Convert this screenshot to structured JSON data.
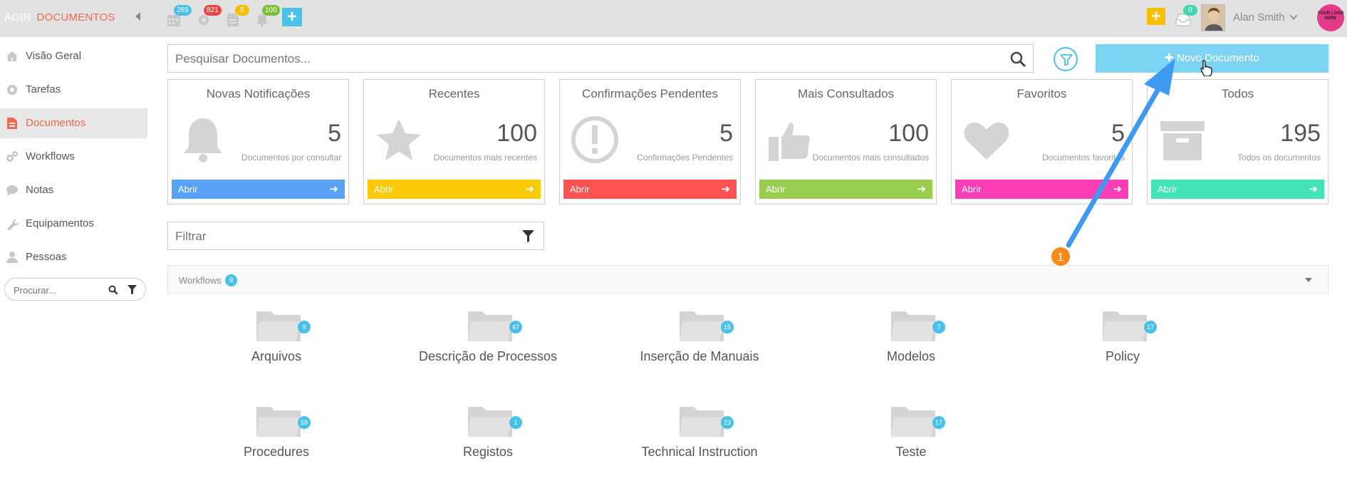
{
  "topbar": {
    "brand_part1": "AGIR",
    "brand_part2": "DOCUMENTOS",
    "calendar_badge": "269",
    "settings_badge": "821",
    "document_badge": "5",
    "bell_badge": "100",
    "inbox_badge": "0",
    "user_name": "Alan Smith",
    "logo_text": "YOUR LOGO HERE",
    "colors": {
      "calendar": "#49c0e8",
      "settings": "#ee4444",
      "document": "#f6c000",
      "bell": "#7cbd3a"
    }
  },
  "sidebar": {
    "items": [
      {
        "label": "Visão Geral",
        "icon": "home-icon"
      },
      {
        "label": "Tarefas",
        "icon": "gear-icon"
      },
      {
        "label": "Documentos",
        "icon": "document-icon",
        "active": true
      },
      {
        "label": "Workflows",
        "icon": "gears-icon"
      },
      {
        "label": "Notas",
        "icon": "chat-icon"
      },
      {
        "label": "Equipamentos",
        "icon": "wrench-icon"
      },
      {
        "label": "Pessoas",
        "icon": "user-icon"
      }
    ],
    "search_placeholder": "Procurar..."
  },
  "main": {
    "search_placeholder": "Pesquisar Documentos...",
    "new_document_label": "Novo Documento",
    "filter_placeholder": "Filtrar",
    "cards": [
      {
        "title": "Novas Notificações",
        "count": "5",
        "subtitle": "Documentos por consultar",
        "button": "Abrir",
        "color": "#5aa2f5",
        "icon": "bell-icon"
      },
      {
        "title": "Recentes",
        "count": "100",
        "subtitle": "Documentos mais recentes",
        "button": "Abrir",
        "color": "#fbc905",
        "icon": "star-icon"
      },
      {
        "title": "Confirmações Pendentes",
        "count": "5",
        "subtitle": "Confirmações Pendentes",
        "button": "Abrir",
        "color": "#ff5252",
        "icon": "exclamation-icon"
      },
      {
        "title": "Mais Consultados",
        "count": "100",
        "subtitle": "Documentos mais consultados",
        "button": "Abrir",
        "color": "#98cd50",
        "icon": "thumbs-up-icon"
      },
      {
        "title": "Favoritos",
        "count": "5",
        "subtitle": "Documentos favoritos",
        "button": "Abrir",
        "color": "#fb3eb5",
        "icon": "heart-icon"
      },
      {
        "title": "Todos",
        "count": "195",
        "subtitle": "Todos os documentos",
        "button": "Abrir",
        "color": "#44e3b7",
        "icon": "archive-icon"
      }
    ],
    "workflows": {
      "label": "Workflows",
      "count": "9",
      "folders": [
        {
          "name": "Arquivos",
          "count": "9"
        },
        {
          "name": "Descrição de Processos",
          "count": "47"
        },
        {
          "name": "Inserção de Manuais",
          "count": "15"
        },
        {
          "name": "Modelos",
          "count": "7"
        },
        {
          "name": "Policy",
          "count": "17"
        },
        {
          "name": "Procedures",
          "count": "59"
        },
        {
          "name": "Registos",
          "count": "1"
        },
        {
          "name": "Technical Instruction",
          "count": "23"
        },
        {
          "name": "Teste",
          "count": "17"
        }
      ]
    }
  },
  "annotation": {
    "callout_number": "1",
    "arrow_color": "#3d9af0",
    "callout_color": "#f58a1f"
  }
}
